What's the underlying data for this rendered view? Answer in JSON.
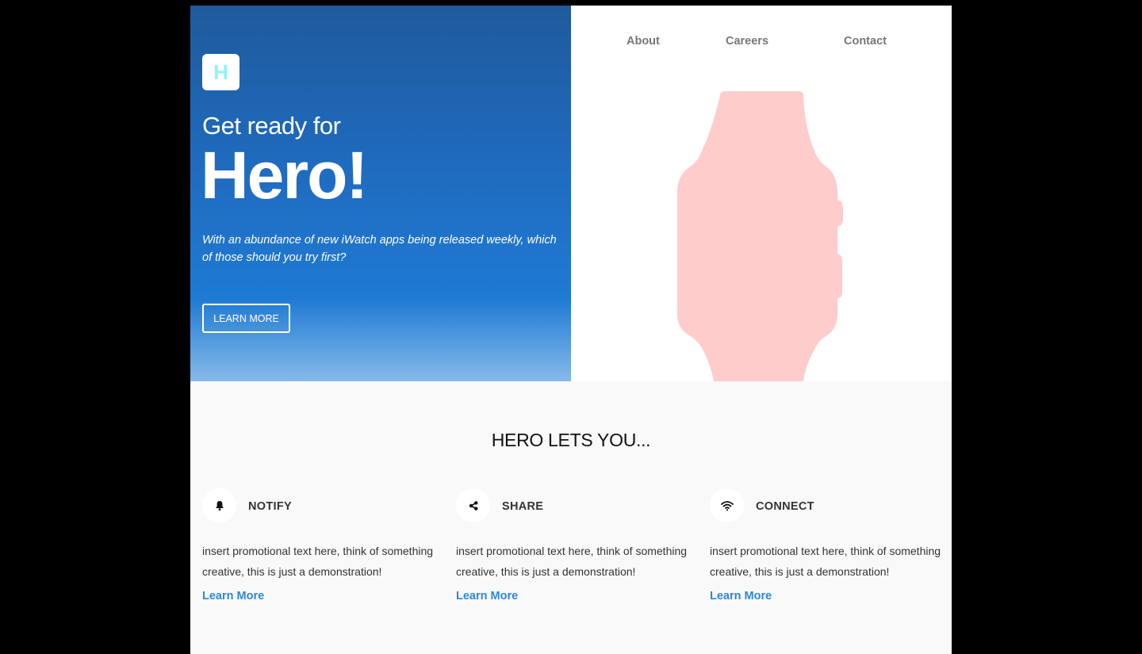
{
  "hero": {
    "logo_letter": "H",
    "eyebrow": "Get ready for",
    "title": "Hero!",
    "description": "With an abundance of new iWatch apps being released weekly, which of those should you try first?",
    "cta_label": "LEARN MORE"
  },
  "nav": {
    "items": [
      {
        "label": "About"
      },
      {
        "label": "Careers"
      },
      {
        "label": "Contact"
      }
    ]
  },
  "features": {
    "title": "HERO LETS YOU...",
    "items": [
      {
        "icon": "bell-icon",
        "name": "NOTIFY",
        "text": "insert promotional text here, think of something creative, this is just a demonstration!",
        "link": "Learn More"
      },
      {
        "icon": "share-icon",
        "name": "SHARE",
        "text": "insert promotional text here, think of something creative, this is just a demonstration!",
        "link": "Learn More"
      },
      {
        "icon": "wifi-icon",
        "name": "CONNECT",
        "text": "insert promotional text here, think of something creative, this is just a demonstration!",
        "link": "Learn More"
      }
    ]
  },
  "colors": {
    "background": "#000000",
    "hero_gradient_top": "#1f5a9c",
    "hero_gradient_bottom": "#86b9ea",
    "logo_letter": "#8ff3f7",
    "watch": "#ffcccc",
    "link": "#2d87d8",
    "nav_text": "#777777"
  }
}
